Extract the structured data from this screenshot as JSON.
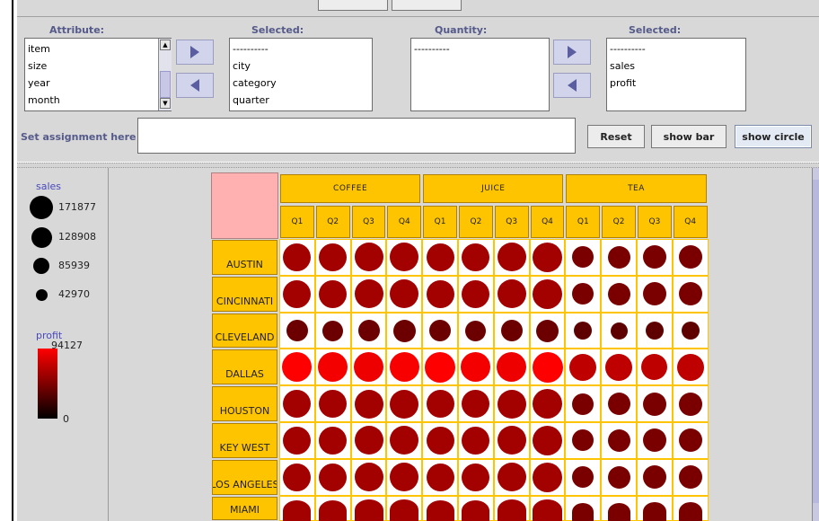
{
  "panel": {
    "attribute_header": "Attribute:",
    "selected_header_1": "Selected:",
    "quantity_header": "Quantity:",
    "selected_header_2": "Selected:",
    "attribute_list": [
      "item",
      "size",
      "year",
      "month"
    ],
    "selected_attributes": [
      "----------",
      "city",
      "category",
      "quarter"
    ],
    "quantity_list": [
      "----------"
    ],
    "selected_quantities": [
      "----------",
      "sales",
      "profit"
    ],
    "assignment_label": "Set assignment here :",
    "assignment_value": "",
    "reset_label": "Reset",
    "show_bar_label": "show bar",
    "show_circle_label": "show circle"
  },
  "legend": {
    "sales_title": "sales",
    "sales_levels": [
      {
        "label": "171877",
        "value": 171877
      },
      {
        "label": "128908",
        "value": 128908
      },
      {
        "label": "85939",
        "value": 85939
      },
      {
        "label": "42970",
        "value": 42970
      }
    ],
    "profit_title": "profit",
    "profit_max": "94127",
    "profit_min": "0",
    "colors": {
      "profit_high": "#ff0000",
      "profit_low": "#000000",
      "header": "#ffc400",
      "corner": "#ffb0b0"
    }
  },
  "chart_data": {
    "type": "table",
    "encoding": "circle size = sales, circle color = profit",
    "products": [
      "COFFEE",
      "JUICE",
      "TEA"
    ],
    "quarters": [
      "Q1",
      "Q2",
      "Q3",
      "Q4"
    ],
    "cities": [
      "AUSTIN",
      "CINCINNATI",
      "CLEVELAND",
      "DALLAS",
      "HOUSTON",
      "KEY WEST",
      "LOS ANGELES",
      "MIAMI"
    ],
    "sales_max": 171877,
    "profit_max": 94127,
    "sales": [
      [
        142000,
        145000,
        150000,
        150000,
        142000,
        145000,
        150000,
        160000,
        88000,
        92000,
        98000,
        100000
      ],
      [
        142000,
        145000,
        155000,
        150000,
        142000,
        145000,
        150000,
        160000,
        88000,
        92000,
        98000,
        100000
      ],
      [
        88000,
        80000,
        85000,
        92000,
        88000,
        80000,
        85000,
        92000,
        60000,
        55000,
        57000,
        62000
      ],
      [
        160000,
        160000,
        160000,
        160000,
        171877,
        160000,
        160000,
        171000,
        130000,
        130000,
        125000,
        130000
      ],
      [
        142000,
        145000,
        150000,
        150000,
        142000,
        145000,
        150000,
        160000,
        88000,
        92000,
        98000,
        100000
      ],
      [
        142000,
        145000,
        150000,
        150000,
        142000,
        145000,
        150000,
        160000,
        88000,
        92000,
        98000,
        100000
      ],
      [
        142000,
        145000,
        150000,
        150000,
        142000,
        145000,
        150000,
        160000,
        88000,
        92000,
        98000,
        100000
      ],
      [
        142000,
        145000,
        150000,
        150000,
        142000,
        145000,
        150000,
        160000,
        88000,
        92000,
        98000,
        100000
      ]
    ],
    "profit": [
      [
        60000,
        60000,
        60000,
        60000,
        60000,
        60000,
        60000,
        60000,
        45000,
        45000,
        45000,
        45000
      ],
      [
        60000,
        60000,
        60000,
        60000,
        60000,
        60000,
        60000,
        60000,
        45000,
        45000,
        45000,
        45000
      ],
      [
        40000,
        40000,
        40000,
        40000,
        40000,
        40000,
        40000,
        40000,
        35000,
        35000,
        35000,
        35000
      ],
      [
        94127,
        90000,
        88000,
        92000,
        94127,
        90000,
        88000,
        94000,
        70000,
        70000,
        70000,
        70000
      ],
      [
        60000,
        60000,
        60000,
        60000,
        60000,
        60000,
        60000,
        60000,
        45000,
        45000,
        45000,
        45000
      ],
      [
        60000,
        60000,
        60000,
        60000,
        60000,
        60000,
        60000,
        60000,
        45000,
        45000,
        45000,
        45000
      ],
      [
        60000,
        60000,
        60000,
        60000,
        60000,
        60000,
        60000,
        60000,
        45000,
        45000,
        45000,
        45000
      ],
      [
        60000,
        60000,
        60000,
        60000,
        60000,
        60000,
        60000,
        60000,
        45000,
        45000,
        45000,
        45000
      ]
    ]
  }
}
